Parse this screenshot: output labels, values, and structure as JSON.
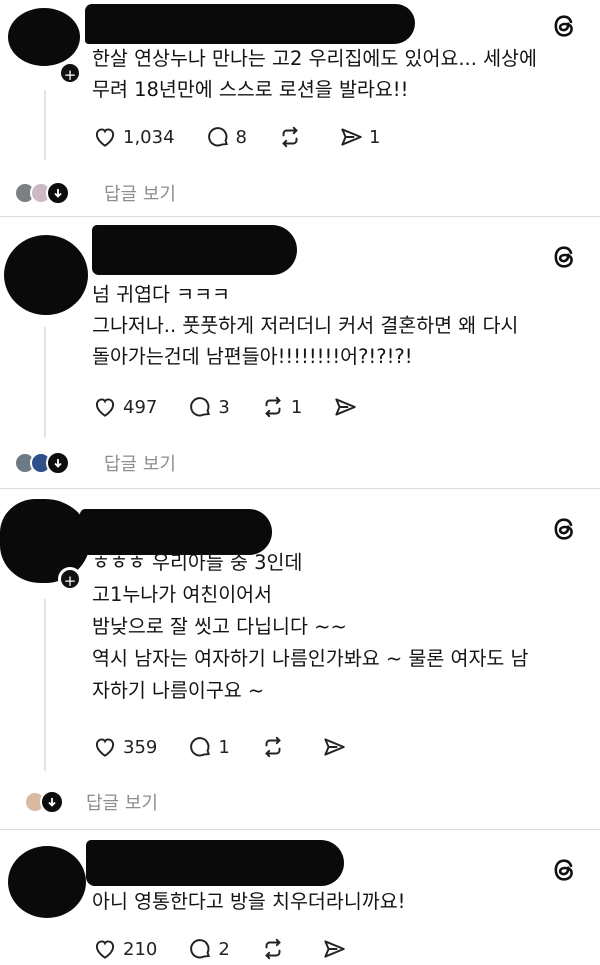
{
  "posts": [
    {
      "lines": [
        "한살 연상누나 만나는 고2 우리집에도 있어요... 세상에",
        "무려 18년만에 스스로 로션을 발라요!!"
      ],
      "likes": "1,034",
      "comments": "8",
      "reposts": "",
      "shares": "1",
      "replies_label": "답글 보기"
    },
    {
      "lines": [
        "넘 귀엽다 ㅋㅋㅋ",
        "그나저나.. 풋풋하게 저러더니 커서 결혼하면 왜 다시",
        "돌아가는건데 남편들아!!!!!!!!어?!?!?!"
      ],
      "likes": "497",
      "comments": "3",
      "reposts": "1",
      "shares": "",
      "replies_label": "답글 보기"
    },
    {
      "lines": [
        "ㅎㅎㅎ 우리아들 중 3인데",
        "고1누나가 여친이어서",
        "밤낮으로 잘 씻고 다닙니다 ~~",
        "역시 남자는 여자하기 나름인가봐요 ~ 물론 여자도 남",
        "자하기 나름이구요 ~"
      ],
      "likes": "359",
      "comments": "1",
      "reposts": "",
      "shares": "",
      "replies_label": "답글 보기"
    },
    {
      "lines": [
        "아니 영통한다고 방을 치우더라니까요!"
      ],
      "likes": "210",
      "comments": "2",
      "reposts": "",
      "shares": ""
    }
  ],
  "icons": {
    "like": "heart-icon",
    "comment": "comment-bubble-icon",
    "repost": "repost-icon",
    "share": "send-icon",
    "brand": "threads-logo-icon"
  }
}
